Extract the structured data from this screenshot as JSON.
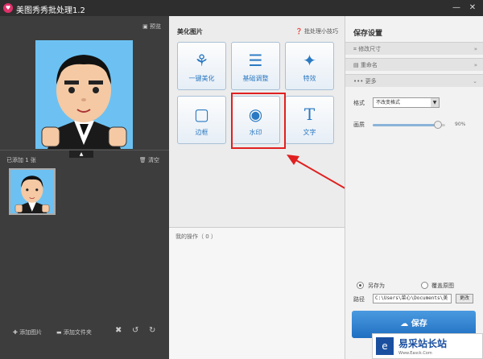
{
  "window": {
    "title": "美图秀秀批处理1.2",
    "controls": [
      "—",
      "✕"
    ]
  },
  "left_panel": {
    "preview_label": "预览",
    "added_count_label": "已添加 1 张",
    "clear_label": "清空",
    "toolbar": {
      "add_image": "添加图片",
      "add_folder": "添加文件夹"
    }
  },
  "middle_panel": {
    "heading": "美化图片",
    "tips": "批处理小技巧",
    "tools": [
      {
        "label": "一键美化",
        "icon": "tulip-icon"
      },
      {
        "label": "基础调整",
        "icon": "sliders-icon"
      },
      {
        "label": "特效",
        "icon": "magic-wand-icon"
      },
      {
        "label": "边框",
        "icon": "frame-icon"
      },
      {
        "label": "水印",
        "icon": "watermark-icon"
      },
      {
        "label": "文字",
        "icon": "text-icon"
      }
    ],
    "ops_label": "我的操作（ 0 ）"
  },
  "right_panel": {
    "heading": "保存设置",
    "sections": [
      {
        "label": "修改尺寸",
        "state": "collapsed"
      },
      {
        "label": "重命名",
        "state": "collapsed"
      },
      {
        "label": "更多",
        "state": "expanded"
      }
    ],
    "format_label": "格式",
    "format_value": "不改变格式",
    "quality_label": "画质",
    "quality_value": "90%",
    "quality_fraction": 0.9,
    "save_as_label": "另存为",
    "overwrite_label": "覆盖原图",
    "path_label": "路径",
    "path_value": "C:\\Users\\菜心\\Documents\\美",
    "browse_label": "更改",
    "save_label": "保存"
  },
  "watermark_badge": {
    "title": "易采站长站",
    "subtitle": "Www.Easck.Com"
  },
  "colors": {
    "accent_blue": "#1f6fc2",
    "highlight_red": "#e02020",
    "preview_bg": "#6cc1f2"
  }
}
